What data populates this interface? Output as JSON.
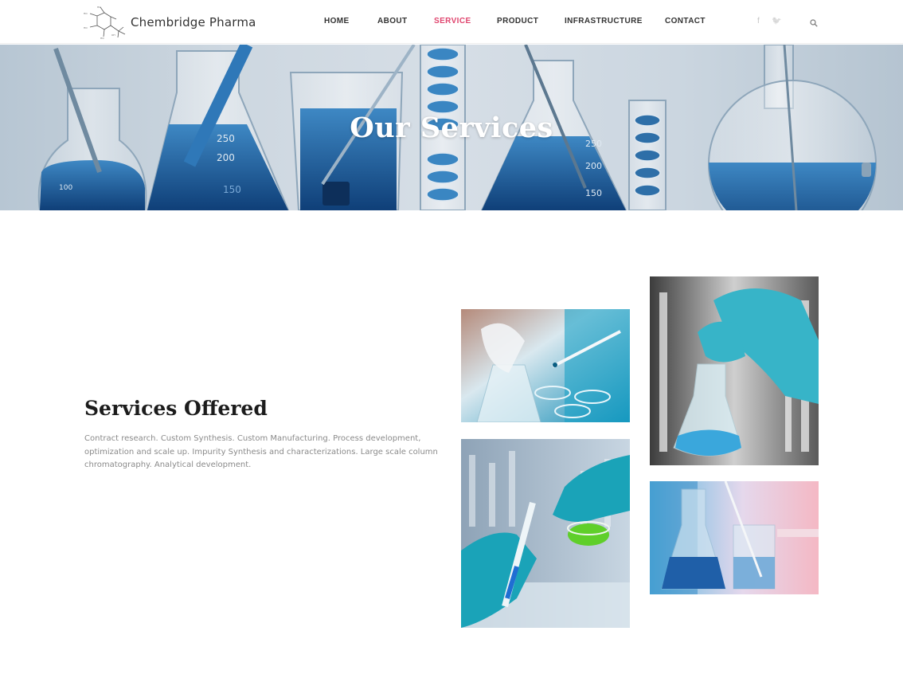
{
  "header": {
    "logo_text": "Chembridge Pharma",
    "nav": [
      {
        "label": "HOME",
        "active": false
      },
      {
        "label": "ABOUT",
        "active": false
      },
      {
        "label": "SERVICE",
        "active": true
      },
      {
        "label": "PRODUCT",
        "active": false
      },
      {
        "label": "INFRASTRUCTURE",
        "active": false
      },
      {
        "label": "CONTACT",
        "active": false
      }
    ],
    "social": {
      "facebook": "f",
      "twitter": "🐦"
    },
    "icons": [
      "molecule-logo-icon",
      "facebook-icon",
      "twitter-icon",
      "search-icon"
    ],
    "accent_color": "#e0466f"
  },
  "hero": {
    "title": "Our Services"
  },
  "main": {
    "title": "Services Offered",
    "description": "Contract research. Custom Synthesis. Custom Manufacturing. Process development, optimization and scale up. Impurity Synthesis and characterizations. Large scale column chromatography. Analytical development."
  }
}
